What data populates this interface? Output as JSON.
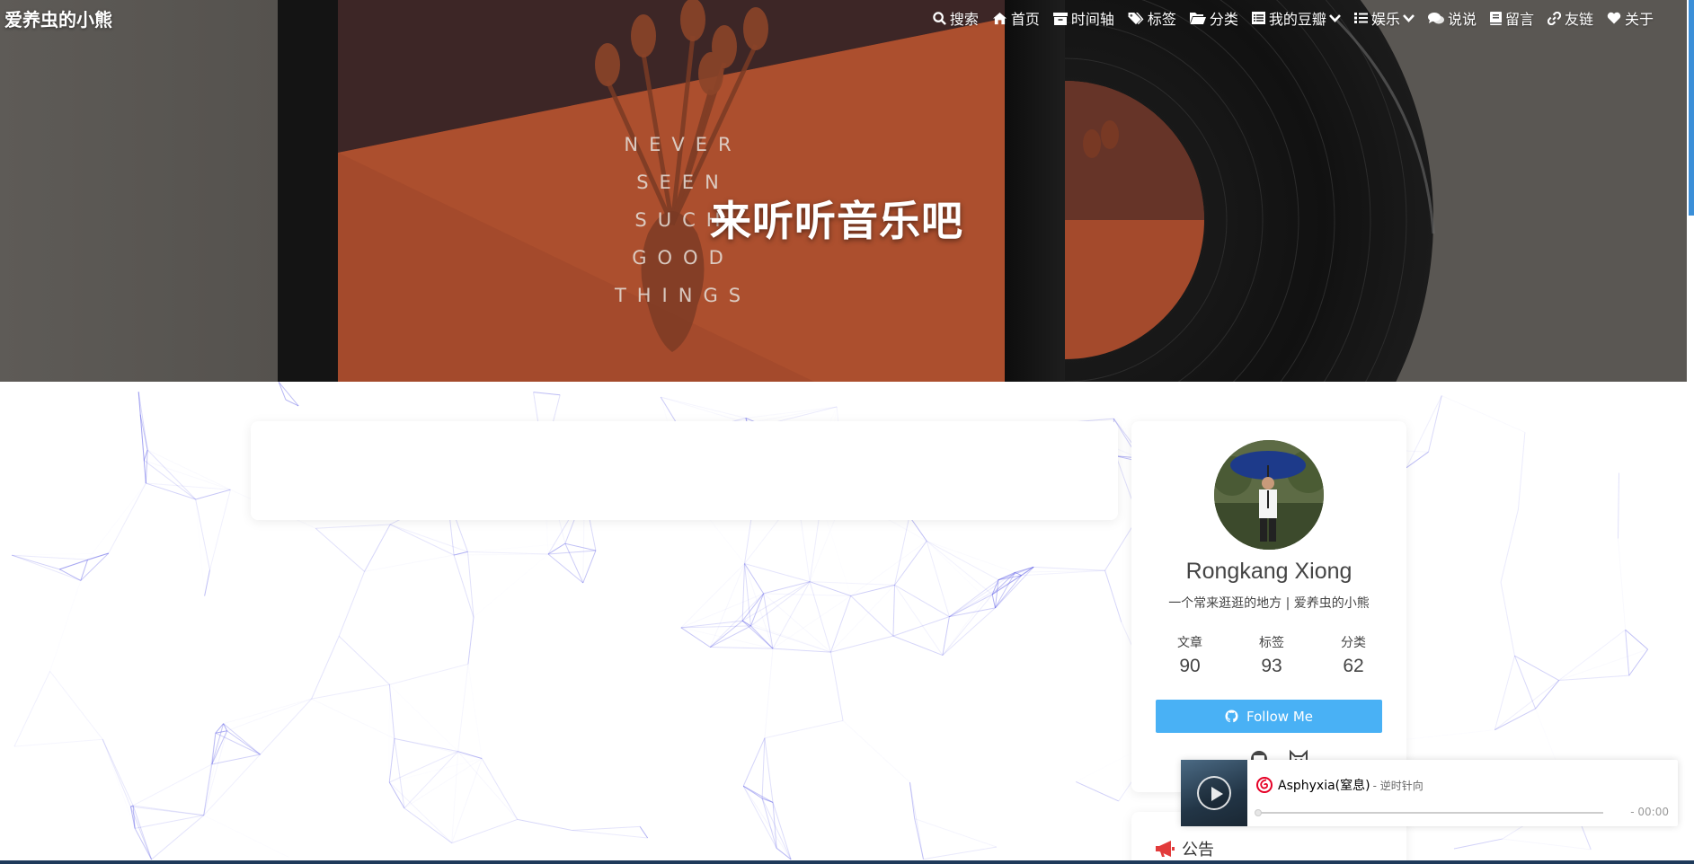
{
  "brand": "爱养虫的小熊",
  "nav": {
    "items": [
      {
        "label": "搜索",
        "icon": "search-icon"
      },
      {
        "label": "首页",
        "icon": "home-icon"
      },
      {
        "label": "时间轴",
        "icon": "archive-icon"
      },
      {
        "label": "标签",
        "icon": "tags-icon"
      },
      {
        "label": "分类",
        "icon": "folder-open-icon"
      },
      {
        "label": "我的豆瓣",
        "icon": "list-alt-icon",
        "dropdown": true
      },
      {
        "label": "娱乐",
        "icon": "list-icon",
        "dropdown": true
      },
      {
        "label": "说说",
        "icon": "comments-icon"
      },
      {
        "label": "留言",
        "icon": "book-icon"
      },
      {
        "label": "友链",
        "icon": "link-icon"
      },
      {
        "label": "关于",
        "icon": "heart-icon"
      }
    ]
  },
  "hero": {
    "title": "来听听音乐吧",
    "album_text": [
      "NEVER",
      "SEEN",
      "SUCH",
      "GOOD",
      "THINGS"
    ]
  },
  "profile": {
    "name": "Rongkang Xiong",
    "description": "一个常来逛逛的地方 | 爱养虫的小熊",
    "stats": [
      {
        "label": "文章",
        "value": "90"
      },
      {
        "label": "标签",
        "value": "93"
      },
      {
        "label": "分类",
        "value": "62"
      }
    ],
    "follow_label": "Follow Me",
    "social_icons": [
      "github-icon",
      "cat-icon"
    ]
  },
  "notice": {
    "title": "公告"
  },
  "player": {
    "song": "Asphyxia(窒息)",
    "artist": "- 逆时针向",
    "time": "- 00:00",
    "progress": 0
  },
  "colors": {
    "accent": "#49b1f5",
    "notice_icon": "#e23b3b",
    "netease_red": "#e60026",
    "network_lines": "#5a5ae6"
  }
}
